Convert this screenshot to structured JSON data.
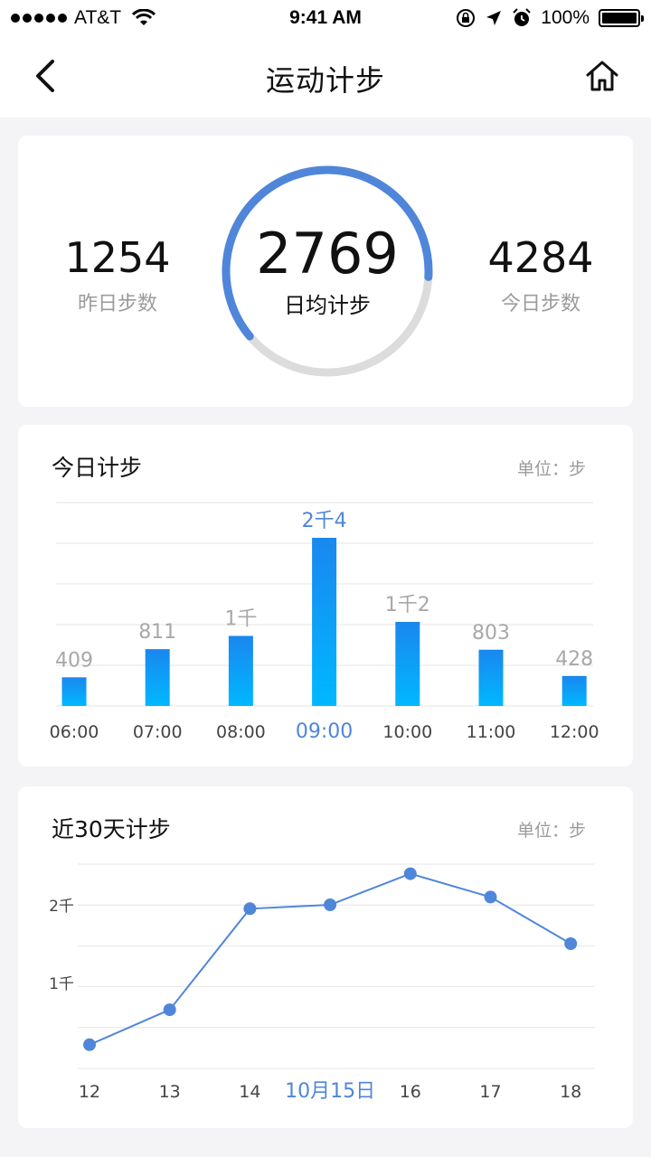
{
  "status_bar": {
    "carrier": "AT&T",
    "time": "9:41 AM",
    "battery": "100%"
  },
  "nav": {
    "title": "运动计步"
  },
  "summary": {
    "yesterday_value": "1254",
    "yesterday_label": "昨日步数",
    "average_value": "2769",
    "average_label": "日均计步",
    "today_value": "4284",
    "today_label": "今日步数",
    "progress": 0.62
  },
  "colors": {
    "accent": "#4f86d9",
    "bar_top": "#1a87ef",
    "bar_bottom": "#00b8ff",
    "ring_track": "#dcdcdc",
    "muted": "#9b9b9b"
  },
  "today_chart": {
    "title": "今日计步",
    "unit": "单位：步"
  },
  "month_chart": {
    "title": "近30天计步",
    "unit": "单位：步"
  },
  "chart_data": [
    {
      "type": "bar",
      "categories": [
        "06:00",
        "07:00",
        "08:00",
        "09:00",
        "10:00",
        "11:00",
        "12:00"
      ],
      "values": [
        409,
        811,
        1000,
        2400,
        1200,
        803,
        428
      ],
      "bar_labels": [
        "409",
        "811",
        "1千",
        "2千4",
        "1千2",
        "803",
        "428"
      ],
      "highlight_index": 3
    },
    {
      "type": "line",
      "x": [
        "12",
        "13",
        "14",
        "10月15日",
        "16",
        "17",
        "18"
      ],
      "values": [
        200,
        650,
        1950,
        2000,
        2400,
        2100,
        1500
      ],
      "y_tick_labels": [
        "1千",
        "2千"
      ],
      "highlight_index": 3,
      "markers": [
        true,
        true,
        true,
        true,
        true,
        true,
        true
      ],
      "marker_skip_index": 3
    }
  ]
}
